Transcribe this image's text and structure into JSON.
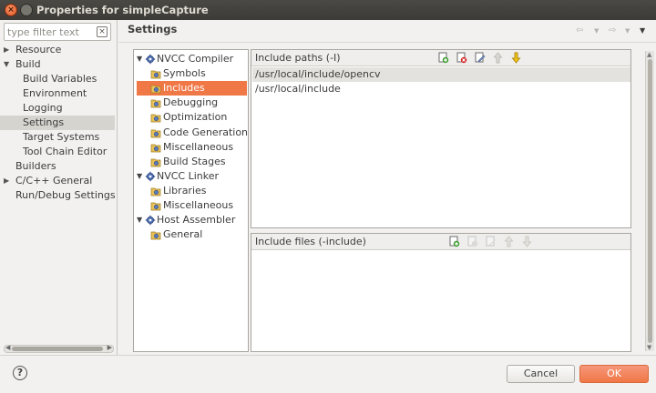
{
  "window": {
    "title": "Properties for simpleCapture",
    "close_glyph": "×"
  },
  "left": {
    "filter_placeholder": "type filter text",
    "nav": [
      {
        "label": "Resource",
        "level": 0,
        "arrow": "▶"
      },
      {
        "label": "Build",
        "level": 0,
        "arrow": "▼"
      },
      {
        "label": "Build Variables",
        "level": 1
      },
      {
        "label": "Environment",
        "level": 1
      },
      {
        "label": "Logging",
        "level": 1
      },
      {
        "label": "Settings",
        "level": 1,
        "selected": true
      },
      {
        "label": "Target Systems",
        "level": 1
      },
      {
        "label": "Tool Chain Editor",
        "level": 1
      },
      {
        "label": "Builders",
        "level": 0
      },
      {
        "label": "C/C++ General",
        "level": 0,
        "arrow": "▶"
      },
      {
        "label": "Run/Debug Settings",
        "level": 0
      }
    ]
  },
  "right": {
    "title": "Settings",
    "nav_icons": [
      "back-arrow-icon",
      "dropdown-icon",
      "forward-arrow-icon",
      "dropdown-icon",
      "menu-dropdown-icon"
    ],
    "tool_tree": [
      {
        "label": "NVCC Compiler",
        "level": 0,
        "arrow": "▼",
        "icon": "tool-gear-icon"
      },
      {
        "label": "Symbols",
        "level": 1,
        "icon": "setting-icon"
      },
      {
        "label": "Includes",
        "level": 1,
        "icon": "setting-icon",
        "selected": true
      },
      {
        "label": "Debugging",
        "level": 1,
        "icon": "setting-icon"
      },
      {
        "label": "Optimization",
        "level": 1,
        "icon": "setting-icon"
      },
      {
        "label": "Code Generation",
        "level": 1,
        "icon": "setting-icon"
      },
      {
        "label": "Miscellaneous",
        "level": 1,
        "icon": "setting-icon"
      },
      {
        "label": "Build Stages",
        "level": 1,
        "icon": "setting-icon"
      },
      {
        "label": "NVCC Linker",
        "level": 0,
        "arrow": "▼",
        "icon": "tool-gear-icon"
      },
      {
        "label": "Libraries",
        "level": 1,
        "icon": "setting-icon"
      },
      {
        "label": "Miscellaneous",
        "level": 1,
        "icon": "setting-icon"
      },
      {
        "label": "Host Assembler",
        "level": 0,
        "arrow": "▼",
        "icon": "tool-gear-icon"
      },
      {
        "label": "General",
        "level": 1,
        "icon": "setting-icon"
      }
    ],
    "include_paths": {
      "title": "Include paths (-I)",
      "items": [
        "/usr/local/include/opencv",
        "/usr/local/include"
      ],
      "toolbar": [
        "add-icon",
        "delete-icon",
        "edit-icon",
        "move-up-icon",
        "move-down-icon"
      ]
    },
    "include_files": {
      "title": "Include files (-include)",
      "items": [],
      "toolbar": [
        "add-icon",
        "delete-icon",
        "edit-icon",
        "move-up-icon",
        "move-down-icon"
      ]
    }
  },
  "footer": {
    "help_glyph": "?",
    "cancel_label": "Cancel",
    "ok_label": "OK"
  },
  "colors": {
    "accent": "#f07746",
    "title_bar": "#3c3b37",
    "background": "#f2f1f0"
  }
}
